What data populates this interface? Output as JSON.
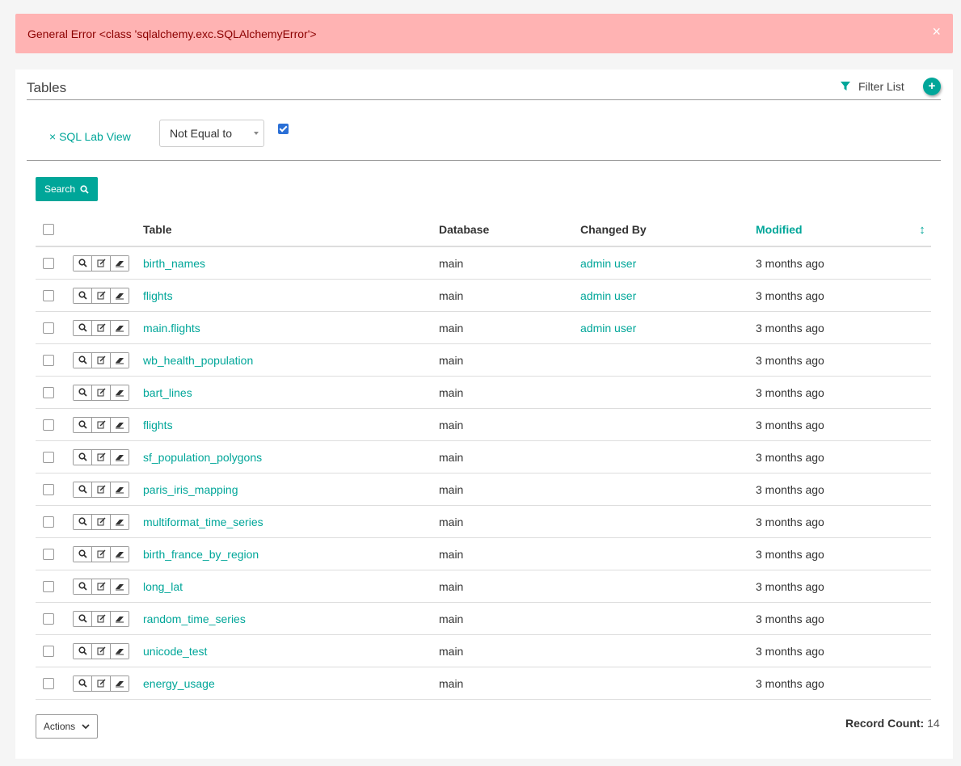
{
  "alert": {
    "message": "General Error <class 'sqlalchemy.exc.SQLAlchemyError'>",
    "close_label": "×"
  },
  "panel": {
    "title": "Tables",
    "filter_list_label": "Filter List",
    "add_label": "+"
  },
  "filter": {
    "remove_label": "× SQL Lab View",
    "operator": "Not Equal to",
    "checked": true
  },
  "search_button": {
    "label": "Search"
  },
  "table": {
    "columns": {
      "table": "Table",
      "database": "Database",
      "changed_by": "Changed By",
      "modified": "Modified"
    },
    "rows": [
      {
        "table": "birth_names",
        "database": "main",
        "changed_by": "admin user",
        "modified": "3 months ago"
      },
      {
        "table": "flights",
        "database": "main",
        "changed_by": "admin user",
        "modified": "3 months ago"
      },
      {
        "table": "main.flights",
        "database": "main",
        "changed_by": "admin user",
        "modified": "3 months ago"
      },
      {
        "table": "wb_health_population",
        "database": "main",
        "changed_by": "",
        "modified": "3 months ago"
      },
      {
        "table": "bart_lines",
        "database": "main",
        "changed_by": "",
        "modified": "3 months ago"
      },
      {
        "table": "flights",
        "database": "main",
        "changed_by": "",
        "modified": "3 months ago"
      },
      {
        "table": "sf_population_polygons",
        "database": "main",
        "changed_by": "",
        "modified": "3 months ago"
      },
      {
        "table": "paris_iris_mapping",
        "database": "main",
        "changed_by": "",
        "modified": "3 months ago"
      },
      {
        "table": "multiformat_time_series",
        "database": "main",
        "changed_by": "",
        "modified": "3 months ago"
      },
      {
        "table": "birth_france_by_region",
        "database": "main",
        "changed_by": "",
        "modified": "3 months ago"
      },
      {
        "table": "long_lat",
        "database": "main",
        "changed_by": "",
        "modified": "3 months ago"
      },
      {
        "table": "random_time_series",
        "database": "main",
        "changed_by": "",
        "modified": "3 months ago"
      },
      {
        "table": "unicode_test",
        "database": "main",
        "changed_by": "",
        "modified": "3 months ago"
      },
      {
        "table": "energy_usage",
        "database": "main",
        "changed_by": "",
        "modified": "3 months ago"
      }
    ]
  },
  "actions_button": {
    "label": "Actions"
  },
  "record_count": {
    "label": "Record Count:",
    "value": "14"
  },
  "colors": {
    "accent": "#00a699",
    "alert_bg": "#ffb3b3",
    "alert_text": "#8b0000"
  }
}
